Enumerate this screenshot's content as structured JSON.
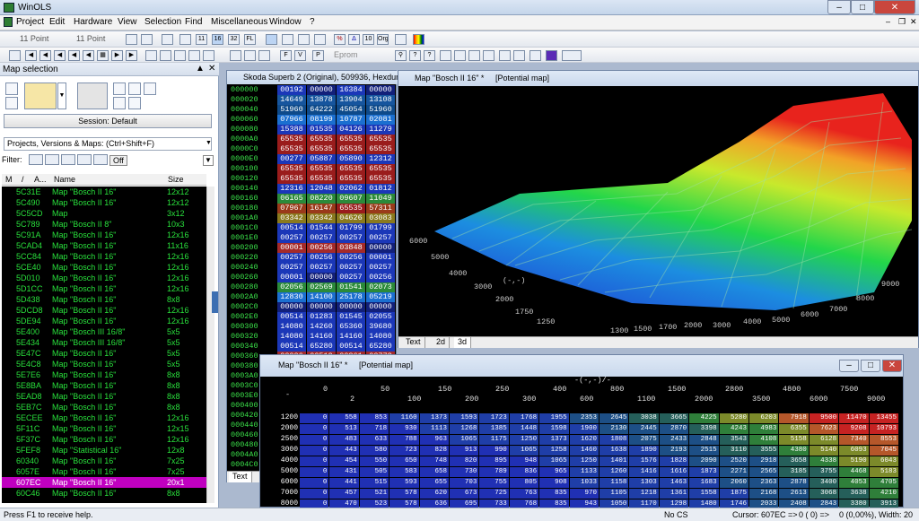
{
  "app": {
    "title": "WinOLS"
  },
  "menu": [
    "Project",
    "Edit",
    "Hardware",
    "View",
    "Selection",
    "Find",
    "Miscellaneous",
    "Window",
    "?"
  ],
  "toolbar": {
    "font1": "11 Point",
    "font2": "11 Point",
    "eprom": "Eprom",
    "btn_11": "11",
    "btn_16": "16",
    "btn_32": "32",
    "btn_fl": "FL",
    "btn_org": "Org",
    "btn_10": "10"
  },
  "left_panel": {
    "title": "Map selection",
    "session": "Session: Default",
    "project_select": "Projects, Versions & Maps: (Ctrl+Shift+F)",
    "filter_label": "Filter:",
    "filter_off": "Off",
    "columns": [
      "M",
      "/",
      "A...",
      "Name",
      "Size"
    ],
    "rows": [
      [
        "5C31E",
        "Map \"Bosch II 16\"",
        "12x12"
      ],
      [
        "5C490",
        "Map \"Bosch II 16\"",
        "12x12"
      ],
      [
        "5C5CD",
        "Map",
        "3x12"
      ],
      [
        "5C789",
        "Map \"Bosch II 8\"",
        "10x3"
      ],
      [
        "5C91A",
        "Map \"Bosch II 16\"",
        "12x16"
      ],
      [
        "5CAD4",
        "Map \"Bosch II 16\"",
        "11x16"
      ],
      [
        "5CC84",
        "Map \"Bosch II 16\"",
        "12x16"
      ],
      [
        "5CE40",
        "Map \"Bosch II 16\"",
        "12x16"
      ],
      [
        "5D010",
        "Map \"Bosch II 16\"",
        "12x16"
      ],
      [
        "5D1CC",
        "Map \"Bosch II 16\"",
        "12x16"
      ],
      [
        "5D438",
        "Map \"Bosch II 16\"",
        "8x8"
      ],
      [
        "5DCD8",
        "Map \"Bosch II 16\"",
        "12x16"
      ],
      [
        "5DE94",
        "Map \"Bosch II 16\"",
        "12x16"
      ],
      [
        "5E400",
        "Map \"Bosch III 16/8\"",
        "5x5"
      ],
      [
        "5E434",
        "Map \"Bosch III 16/8\"",
        "5x5"
      ],
      [
        "5E47C",
        "Map \"Bosch II 16\"",
        "5x5"
      ],
      [
        "5E4C8",
        "Map \"Bosch II 16\"",
        "5x5"
      ],
      [
        "5E7E6",
        "Map \"Bosch II 16\"",
        "8x8"
      ],
      [
        "5E8BA",
        "Map \"Bosch II 16\"",
        "8x8"
      ],
      [
        "5EAD8",
        "Map \"Bosch II 16\"",
        "8x8"
      ],
      [
        "5EB7C",
        "Map \"Bosch II 16\"",
        "8x8"
      ],
      [
        "5ECEE",
        "Map \"Bosch II 16\"",
        "12x16"
      ],
      [
        "5F11C",
        "Map \"Bosch II 16\"",
        "12x15"
      ],
      [
        "5F37C",
        "Map \"Bosch II 16\"",
        "12x16"
      ],
      [
        "5FEF8",
        "Map \"Statistical 16\"",
        "12x8"
      ],
      [
        "60340",
        "Map \"Bosch II 16\"",
        "7x25"
      ],
      [
        "6057E",
        "Map \"Bosch II 16\"",
        "7x25"
      ],
      [
        "607EC",
        "Map \"Bosch II 16\"",
        "20x1"
      ],
      [
        "60C46",
        "Map \"Bosch II 16\"",
        "8x8"
      ]
    ],
    "selected_index": 27
  },
  "hex": {
    "title": "Skoda Superb 2 (Original), 509936, Hexdump",
    "tab": "Text",
    "addresses": [
      "000000",
      "000020",
      "000040",
      "000060",
      "000080",
      "0000A0",
      "0000C0",
      "0000E0",
      "000100",
      "000120",
      "000140",
      "000160",
      "000180",
      "0001A0",
      "0001C0",
      "0001E0",
      "000200",
      "000220",
      "000240",
      "000260",
      "000280",
      "0002A0",
      "0002C0",
      "0002E0",
      "000300",
      "000320",
      "000340",
      "000360",
      "000380",
      "0003A0",
      "0003C0",
      "0003E0",
      "000400",
      "000420",
      "000440",
      "000460",
      "000480",
      "0004A0",
      "0004C0",
      "0004E0"
    ],
    "values": [
      [
        "00192",
        "00000",
        "16384",
        "00000"
      ],
      [
        "14649",
        "13878",
        "13904",
        "13108"
      ],
      [
        "51960",
        "64222",
        "45054",
        "51960"
      ],
      [
        "07966",
        "08199",
        "10787",
        "02081"
      ],
      [
        "15388",
        "01535",
        "04126",
        "11279"
      ],
      [
        "65535",
        "65535",
        "65535",
        "65535"
      ],
      [
        "65535",
        "65535",
        "65535",
        "65535"
      ],
      [
        "00277",
        "05887",
        "05890",
        "12312"
      ],
      [
        "65535",
        "65535",
        "65535",
        "65535"
      ],
      [
        "65535",
        "65535",
        "65535",
        "65535"
      ],
      [
        "12316",
        "12048",
        "02062",
        "01812"
      ],
      [
        "06165",
        "08220",
        "09607",
        "11049"
      ],
      [
        "07967",
        "16147",
        "65535",
        "57311"
      ],
      [
        "03342",
        "03342",
        "04626",
        "03083"
      ],
      [
        "00514",
        "01544",
        "01799",
        "01799"
      ],
      [
        "00257",
        "00257",
        "00257",
        "00257"
      ],
      [
        "00001",
        "00256",
        "03848",
        "00000"
      ],
      [
        "00257",
        "00256",
        "00256",
        "00001"
      ],
      [
        "00257",
        "00257",
        "00257",
        "00257"
      ],
      [
        "00001",
        "00000",
        "00257",
        "00256"
      ],
      [
        "02056",
        "02569",
        "01541",
        "02073"
      ],
      [
        "12830",
        "14100",
        "25178",
        "05219"
      ],
      [
        "00000",
        "00000",
        "00000",
        "00000"
      ],
      [
        "00514",
        "01283",
        "01545",
        "02055"
      ],
      [
        "14080",
        "14260",
        "65360",
        "39680"
      ],
      [
        "14080",
        "14160",
        "14160",
        "14080"
      ],
      [
        "00514",
        "65280",
        "00514",
        "65280"
      ],
      [
        "00006",
        "00519",
        "00261",
        "00772"
      ]
    ]
  },
  "map3d": {
    "title": "Map \"Bosch II 16\" *",
    "subtitle": "[Potential map]",
    "tabs": [
      "Text",
      "2d",
      "3d"
    ],
    "y_ticks": [
      "6000",
      "5000",
      "4000",
      "3000",
      "2000",
      "1750",
      "1250"
    ],
    "y_label": "(-,-)",
    "x_ticks": [
      "9000",
      "8000",
      "7000",
      "6000",
      "5000",
      "4000",
      "3000",
      "2000",
      "1700",
      "1500",
      "1300"
    ]
  },
  "table": {
    "title": "Map \"Bosch II 16\" *",
    "subtitle": "[Potential map]",
    "x_axis_label": "-(-,-)/-",
    "corner": "-",
    "x_top": [
      "0",
      "50",
      "150",
      "250",
      "400",
      "800",
      "1500",
      "2800",
      "4800",
      "7500"
    ],
    "x_bottom": [
      "2",
      "100",
      "200",
      "300",
      "600",
      "1100",
      "2000",
      "3500",
      "6000",
      "9000"
    ],
    "y": [
      "1200",
      "2000",
      "2500",
      "3000",
      "4000",
      "5000",
      "6000",
      "7000",
      "8000"
    ],
    "rows": [
      [
        "0",
        "558",
        "853",
        "1160",
        "1373",
        "1593",
        "1723",
        "1768",
        "1955",
        "2353",
        "2645",
        "3038",
        "3665",
        "4225",
        "5280",
        "6203",
        "7918",
        "9500",
        "11470",
        "13455"
      ],
      [
        "0",
        "513",
        "718",
        "930",
        "1113",
        "1268",
        "1385",
        "1448",
        "1598",
        "1900",
        "2130",
        "2445",
        "2870",
        "3398",
        "4243",
        "4983",
        "6355",
        "7623",
        "9208",
        "10793"
      ],
      [
        "0",
        "483",
        "633",
        "788",
        "963",
        "1065",
        "1175",
        "1250",
        "1373",
        "1620",
        "1808",
        "2075",
        "2433",
        "2848",
        "3543",
        "4108",
        "5158",
        "6128",
        "7340",
        "8553"
      ],
      [
        "0",
        "443",
        "580",
        "723",
        "828",
        "913",
        "990",
        "1065",
        "1258",
        "1460",
        "1638",
        "1890",
        "2193",
        "2515",
        "3110",
        "3555",
        "4380",
        "5140",
        "6093",
        "7045"
      ],
      [
        "0",
        "454",
        "550",
        "650",
        "748",
        "820",
        "895",
        "948",
        "1065",
        "1250",
        "1401",
        "1576",
        "1828",
        "2090",
        "2520",
        "2918",
        "3658",
        "4338",
        "5190",
        "6043"
      ],
      [
        "0",
        "431",
        "505",
        "583",
        "658",
        "730",
        "789",
        "836",
        "965",
        "1133",
        "1260",
        "1416",
        "1616",
        "1873",
        "2271",
        "2565",
        "3185",
        "3755",
        "4468",
        "5183"
      ],
      [
        "0",
        "441",
        "515",
        "593",
        "655",
        "703",
        "755",
        "805",
        "908",
        "1033",
        "1158",
        "1303",
        "1463",
        "1683",
        "2060",
        "2363",
        "2878",
        "3400",
        "4053",
        "4705"
      ],
      [
        "0",
        "457",
        "521",
        "578",
        "620",
        "673",
        "725",
        "763",
        "835",
        "970",
        "1105",
        "1218",
        "1361",
        "1558",
        "1875",
        "2168",
        "2613",
        "3068",
        "3638",
        "4210"
      ],
      [
        "0",
        "470",
        "523",
        "578",
        "636",
        "695",
        "733",
        "768",
        "835",
        "943",
        "1050",
        "1170",
        "1298",
        "1480",
        "1746",
        "2033",
        "2408",
        "2843",
        "3380",
        "3913"
      ]
    ]
  },
  "status": {
    "help": "Press F1 to receive help.",
    "cs": "No CS",
    "cursor": "Cursor: 607EC =>",
    "pos": "0 (  0) =>",
    "diff": "0 (0,00%), Width: 20"
  }
}
